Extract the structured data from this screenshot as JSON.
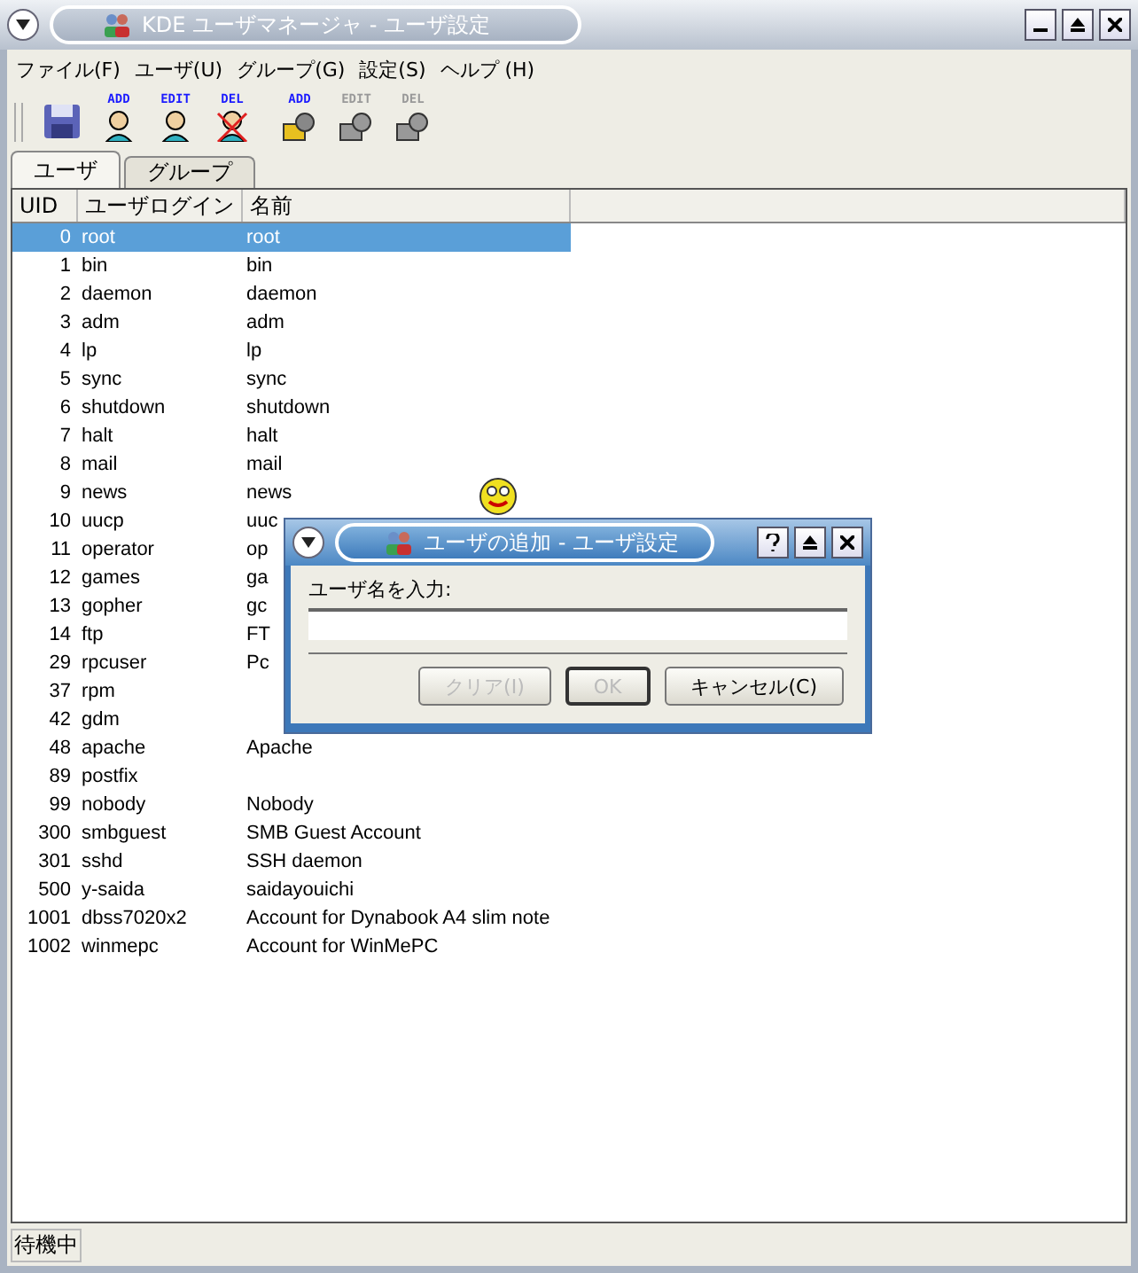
{
  "window": {
    "title": "KDE ユーザマネージャ - ユーザ設定"
  },
  "menu": [
    "ファイル(F)",
    "ユーザ(U)",
    "グループ(G)",
    "設定(S)",
    "ヘルプ (H)"
  ],
  "toolbar": [
    {
      "kind": "save"
    },
    {
      "kind": "user",
      "label": "ADD",
      "disabled": false
    },
    {
      "kind": "user",
      "label": "EDIT",
      "disabled": false
    },
    {
      "kind": "user",
      "label": "DEL",
      "disabled": false
    },
    {
      "kind": "group",
      "label": "ADD",
      "disabled": false
    },
    {
      "kind": "group",
      "label": "EDIT",
      "disabled": true
    },
    {
      "kind": "group",
      "label": "DEL",
      "disabled": true
    }
  ],
  "tabs": [
    {
      "label": "ユーザ",
      "selected": true
    },
    {
      "label": "グループ",
      "selected": false
    }
  ],
  "table": {
    "columns": [
      "UID",
      "ユーザログイン",
      "名前"
    ],
    "rows": [
      {
        "uid": "0",
        "login": "root",
        "name": "root",
        "selected": true
      },
      {
        "uid": "1",
        "login": "bin",
        "name": "bin",
        "selected": false
      },
      {
        "uid": "2",
        "login": "daemon",
        "name": "daemon",
        "selected": false
      },
      {
        "uid": "3",
        "login": "adm",
        "name": "adm",
        "selected": false
      },
      {
        "uid": "4",
        "login": "lp",
        "name": "lp",
        "selected": false
      },
      {
        "uid": "5",
        "login": "sync",
        "name": "sync",
        "selected": false
      },
      {
        "uid": "6",
        "login": "shutdown",
        "name": "shutdown",
        "selected": false
      },
      {
        "uid": "7",
        "login": "halt",
        "name": "halt",
        "selected": false
      },
      {
        "uid": "8",
        "login": "mail",
        "name": "mail",
        "selected": false
      },
      {
        "uid": "9",
        "login": "news",
        "name": "news",
        "selected": false
      },
      {
        "uid": "10",
        "login": "uucp",
        "name": "uuc",
        "selected": false
      },
      {
        "uid": "11",
        "login": "operator",
        "name": "op",
        "selected": false
      },
      {
        "uid": "12",
        "login": "games",
        "name": "ga",
        "selected": false
      },
      {
        "uid": "13",
        "login": "gopher",
        "name": "gc",
        "selected": false
      },
      {
        "uid": "14",
        "login": "ftp",
        "name": "FT",
        "selected": false
      },
      {
        "uid": "29",
        "login": "rpcuser",
        "name": "Pc",
        "selected": false
      },
      {
        "uid": "37",
        "login": "rpm",
        "selected": false
      },
      {
        "uid": "42",
        "login": "gdm",
        "selected": false
      },
      {
        "uid": "48",
        "login": "apache",
        "name": "Apache",
        "selected": false
      },
      {
        "uid": "89",
        "login": "postfix",
        "selected": false
      },
      {
        "uid": "99",
        "login": "nobody",
        "name": "Nobody",
        "selected": false
      },
      {
        "uid": "300",
        "login": "smbguest",
        "name": "SMB Guest Account",
        "selected": false
      },
      {
        "uid": "301",
        "login": "sshd",
        "name": "SSH daemon",
        "selected": false
      },
      {
        "uid": "500",
        "login": "y-saida",
        "name": "saidayouichi",
        "selected": false
      },
      {
        "uid": "1001",
        "login": "dbss7020x2",
        "name": "Account for Dynabook A4 slim note",
        "selected": false
      },
      {
        "uid": "1002",
        "login": "winmepc",
        "name": "Account for WinMePC",
        "selected": false
      }
    ]
  },
  "dialog": {
    "title": "ユーザの追加 - ユーザ設定",
    "prompt": "ユーザ名を入力:",
    "buttons": [
      {
        "label": "クリア(I)",
        "disabled": true,
        "default": false
      },
      {
        "label": "OK",
        "disabled": true,
        "default": true
      },
      {
        "label": "キャンセル(C)",
        "disabled": false,
        "default": false
      }
    ]
  },
  "status_bar": "待機中"
}
